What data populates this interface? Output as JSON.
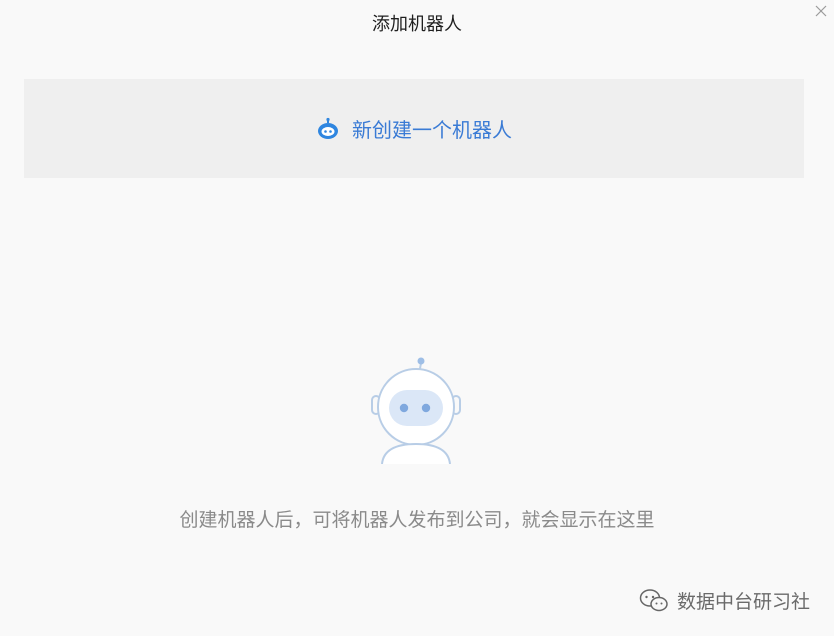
{
  "dialog": {
    "title": "添加机器人",
    "close_icon": "close-icon"
  },
  "create_card": {
    "icon": "robot-head-icon",
    "label": "新创建一个机器人",
    "accent_color": "#3a7bd5"
  },
  "empty_state": {
    "illustration": "robot-illustration",
    "message": "创建机器人后，可将机器人发布到公司，就会显示在这里"
  },
  "watermark": {
    "icon": "wechat-icon",
    "text": "数据中台研习社"
  }
}
